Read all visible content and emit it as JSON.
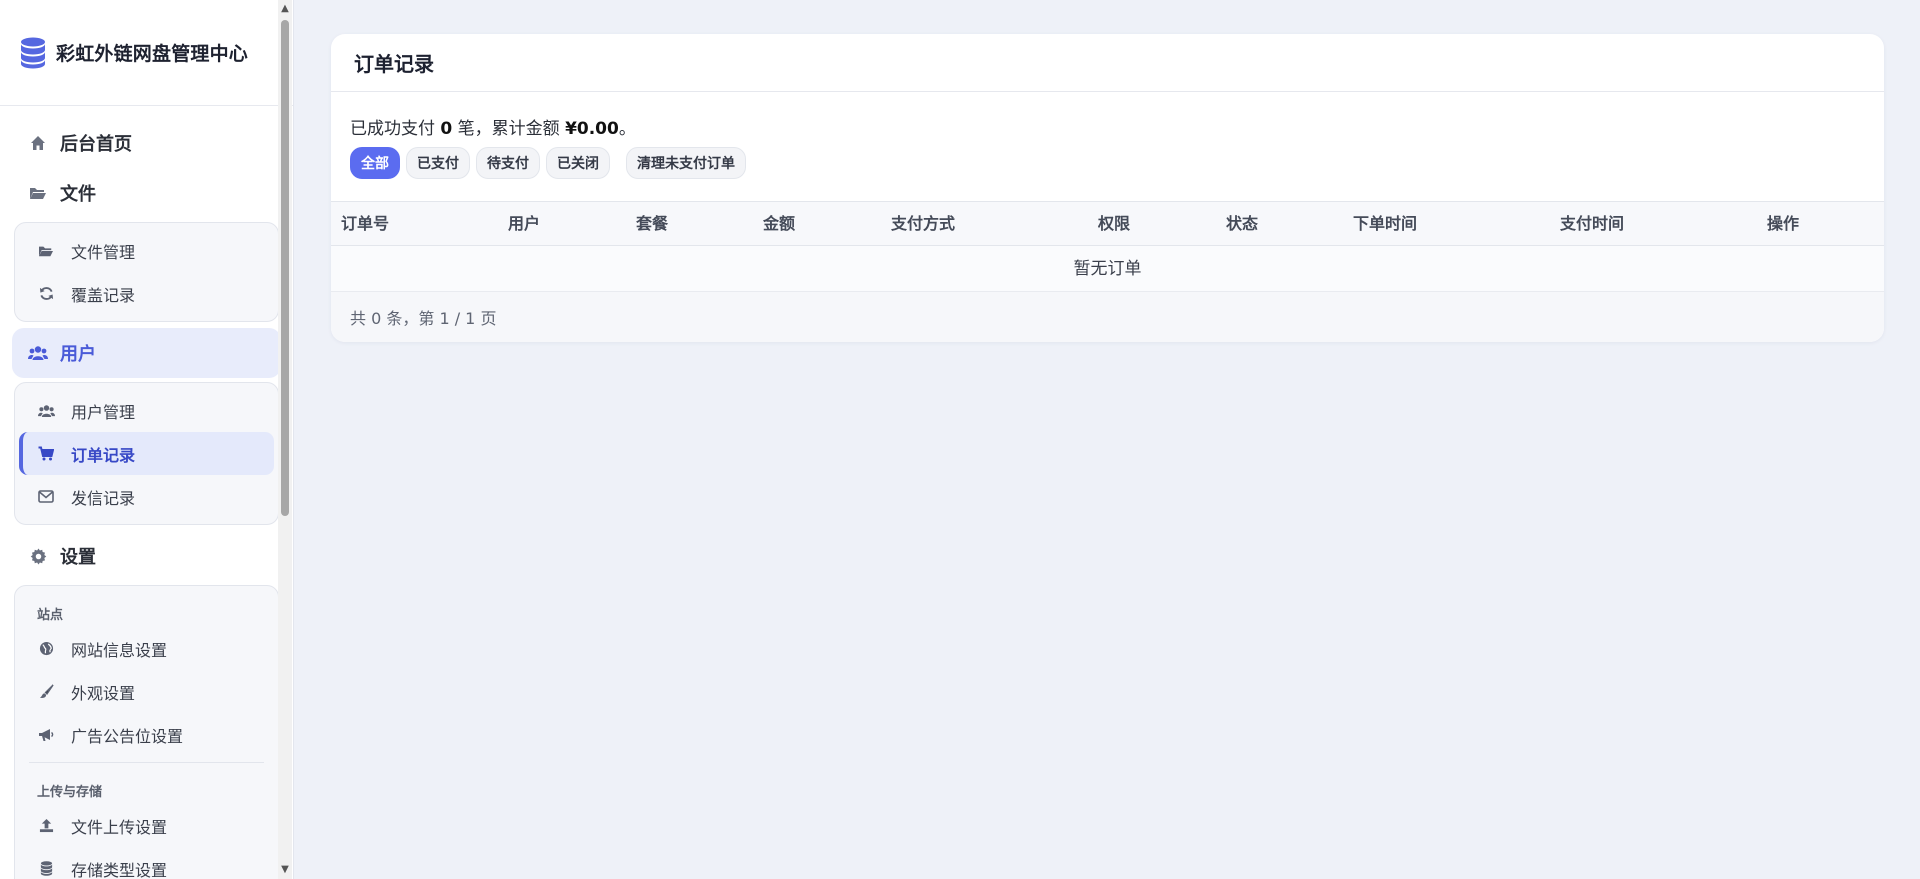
{
  "app": {
    "title": "彩虹外链网盘管理中心"
  },
  "sidebar": {
    "home": "后台首页",
    "files": {
      "label": "文件",
      "items": [
        {
          "label": "文件管理",
          "icon": "folder-open-icon"
        },
        {
          "label": "覆盖记录",
          "icon": "refresh-icon"
        }
      ]
    },
    "users": {
      "label": "用户",
      "items": [
        {
          "label": "用户管理",
          "icon": "users-icon"
        },
        {
          "label": "订单记录",
          "icon": "cart-icon"
        },
        {
          "label": "发信记录",
          "icon": "envelope-icon"
        }
      ]
    },
    "settings": {
      "label": "设置",
      "section_site": "站点",
      "site_items": [
        {
          "label": "网站信息设置",
          "icon": "globe-icon"
        },
        {
          "label": "外观设置",
          "icon": "brush-icon"
        },
        {
          "label": "广告公告位设置",
          "icon": "megaphone-icon"
        }
      ],
      "section_storage": "上传与存储",
      "storage_items": [
        {
          "label": "文件上传设置",
          "icon": "upload-icon"
        },
        {
          "label": "存储类型设置",
          "icon": "database-icon"
        }
      ]
    }
  },
  "main": {
    "card_title": "订单记录",
    "summary": {
      "prefix": "已成功支付 ",
      "count": "0",
      "middle": " 笔，累计金额 ",
      "amount": "¥0.00",
      "suffix": "。"
    },
    "filters": [
      "全部",
      "已支付",
      "待支付",
      "已关闭"
    ],
    "active_filter": "全部",
    "clear_button": "清理未支付订单",
    "table": {
      "columns": [
        "订单号",
        "用户",
        "套餐",
        "金额",
        "支付方式",
        "权限",
        "状态",
        "下单时间",
        "支付时间",
        "操作"
      ],
      "rows": [],
      "empty_text": "暂无订单"
    },
    "pager": "共 0 条，第 1 / 1 页"
  },
  "colors": {
    "accent": "#5b6cf0",
    "active_nav_bg": "#e8ecfb",
    "active_nav_text": "#4a5bd8",
    "page_bg": "#eef1f8"
  }
}
